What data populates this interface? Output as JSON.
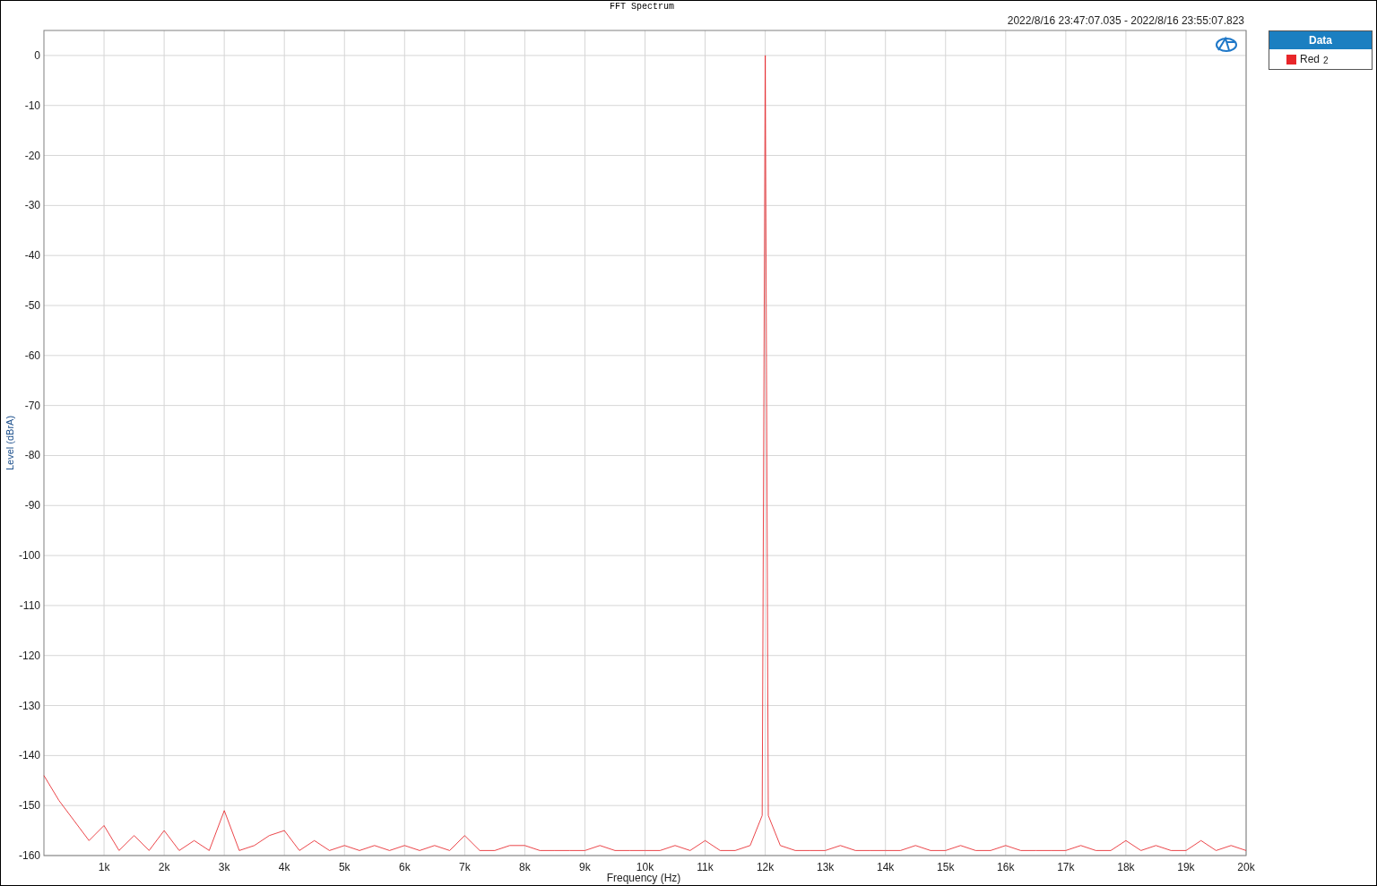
{
  "time_range": "2022/8/16 23:47:07.035 - 2022/8/16 23:55:07.823",
  "chart_data": {
    "type": "line",
    "grid": true,
    "title": "FFT Spectrum",
    "xlabel": "Frequency (Hz)",
    "ylabel": "Level (dBrA)",
    "xlim": [
      0,
      20000
    ],
    "ylim": [
      -160,
      5
    ],
    "xticks": [
      {
        "value": 1000,
        "label": "1k"
      },
      {
        "value": 2000,
        "label": "2k"
      },
      {
        "value": 3000,
        "label": "3k"
      },
      {
        "value": 4000,
        "label": "4k"
      },
      {
        "value": 5000,
        "label": "5k"
      },
      {
        "value": 6000,
        "label": "6k"
      },
      {
        "value": 7000,
        "label": "7k"
      },
      {
        "value": 8000,
        "label": "8k"
      },
      {
        "value": 9000,
        "label": "9k"
      },
      {
        "value": 10000,
        "label": "10k"
      },
      {
        "value": 11000,
        "label": "11k"
      },
      {
        "value": 12000,
        "label": "12k"
      },
      {
        "value": 13000,
        "label": "13k"
      },
      {
        "value": 14000,
        "label": "14k"
      },
      {
        "value": 15000,
        "label": "15k"
      },
      {
        "value": 16000,
        "label": "16k"
      },
      {
        "value": 17000,
        "label": "17k"
      },
      {
        "value": 18000,
        "label": "18k"
      },
      {
        "value": 19000,
        "label": "19k"
      },
      {
        "value": 20000,
        "label": "20k"
      }
    ],
    "yticks": [
      0,
      -10,
      -20,
      -30,
      -40,
      -50,
      -60,
      -70,
      -80,
      -90,
      -100,
      -110,
      -120,
      -130,
      -140,
      -150,
      -160
    ],
    "x": [
      0,
      250,
      500,
      750,
      1000,
      1250,
      1500,
      1750,
      2000,
      2250,
      2500,
      2750,
      3000,
      3250,
      3500,
      3750,
      4000,
      4250,
      4500,
      4750,
      5000,
      5250,
      5500,
      5750,
      6000,
      6250,
      6500,
      6750,
      7000,
      7250,
      7500,
      7750,
      8000,
      8250,
      8500,
      8750,
      9000,
      9250,
      9500,
      9750,
      10000,
      10250,
      10500,
      10750,
      11000,
      11250,
      11500,
      11750,
      11950,
      12000,
      12050,
      12250,
      12500,
      12750,
      13000,
      13250,
      13500,
      13750,
      14000,
      14250,
      14500,
      14750,
      15000,
      15250,
      15500,
      15750,
      16000,
      16250,
      16500,
      16750,
      17000,
      17250,
      17500,
      17750,
      18000,
      18250,
      18500,
      18750,
      19000,
      19250,
      19500,
      19750,
      20000
    ],
    "series": [
      {
        "name": "Red",
        "color": "#e8262a",
        "values": [
          -144,
          -149,
          -153,
          -157,
          -154,
          -159,
          -156,
          -159,
          -155,
          -159,
          -157,
          -159,
          -151,
          -159,
          -158,
          -156,
          -155,
          -159,
          -157,
          -159,
          -158,
          -159,
          -158,
          -159,
          -158,
          -159,
          -158,
          -159,
          -156,
          -159,
          -159,
          -158,
          -158,
          -159,
          -159,
          -159,
          -159,
          -158,
          -159,
          -159,
          -159,
          -159,
          -158,
          -159,
          -157,
          -159,
          -159,
          -158,
          -152,
          0,
          -152,
          -158,
          -159,
          -159,
          -159,
          -158,
          -159,
          -159,
          -159,
          -159,
          -158,
          -159,
          -159,
          -158,
          -159,
          -159,
          -158,
          -159,
          -159,
          -159,
          -159,
          -158,
          -159,
          -159,
          -157,
          -159,
          -158,
          -159,
          -159,
          -157,
          -159,
          -158,
          -159
        ]
      }
    ]
  },
  "legend": {
    "title": "Data",
    "entries": [
      {
        "channel": "2"
      }
    ]
  }
}
